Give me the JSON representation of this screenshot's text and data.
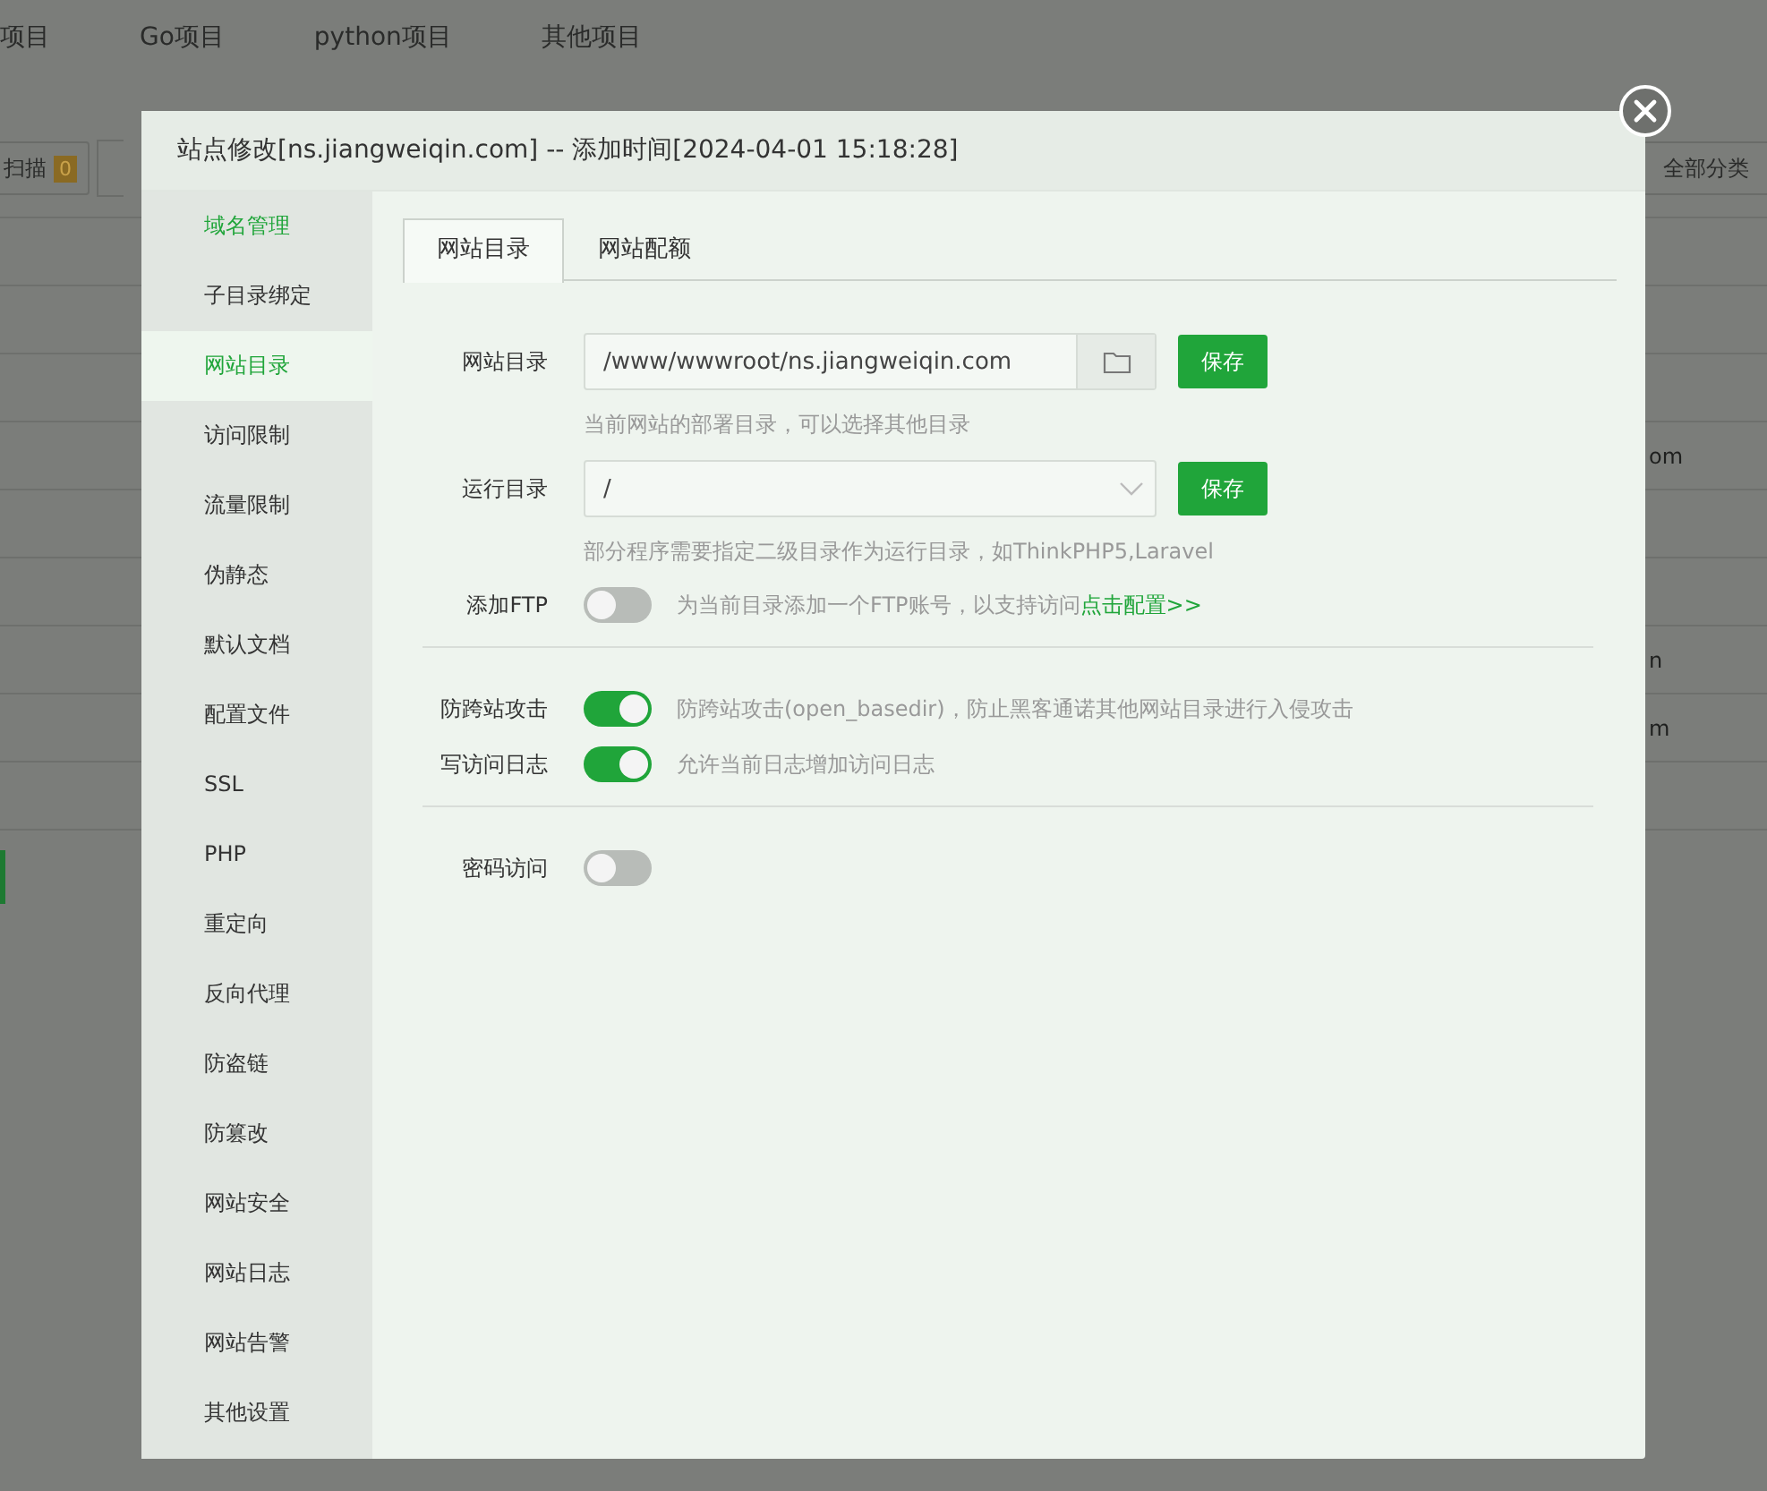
{
  "background": {
    "nav": [
      "项目",
      "Go项目",
      "python项目",
      "其他项目"
    ],
    "scan_button": {
      "label": "扫描",
      "count": "0"
    },
    "category_button": "全部分类",
    "table_fragments": [
      "om",
      "n",
      "m"
    ]
  },
  "dialog": {
    "title": "站点修改[ns.jiangweiqin.com] -- 添加时间[2024-04-01 15:18:28]",
    "sidebar": [
      {
        "label": "域名管理",
        "selected": false,
        "hover": true
      },
      {
        "label": "子目录绑定",
        "selected": false,
        "hover": false
      },
      {
        "label": "网站目录",
        "selected": true,
        "hover": false
      },
      {
        "label": "访问限制",
        "selected": false,
        "hover": false
      },
      {
        "label": "流量限制",
        "selected": false,
        "hover": false
      },
      {
        "label": "伪静态",
        "selected": false,
        "hover": false
      },
      {
        "label": "默认文档",
        "selected": false,
        "hover": false
      },
      {
        "label": "配置文件",
        "selected": false,
        "hover": false
      },
      {
        "label": "SSL",
        "selected": false,
        "hover": false
      },
      {
        "label": "PHP",
        "selected": false,
        "hover": false
      },
      {
        "label": "重定向",
        "selected": false,
        "hover": false
      },
      {
        "label": "反向代理",
        "selected": false,
        "hover": false
      },
      {
        "label": "防盗链",
        "selected": false,
        "hover": false
      },
      {
        "label": "防篡改",
        "selected": false,
        "hover": false
      },
      {
        "label": "网站安全",
        "selected": false,
        "hover": false
      },
      {
        "label": "网站日志",
        "selected": false,
        "hover": false
      },
      {
        "label": "网站告警",
        "selected": false,
        "hover": false
      },
      {
        "label": "其他设置",
        "selected": false,
        "hover": false
      }
    ],
    "tabs": [
      {
        "label": "网站目录",
        "selected": true
      },
      {
        "label": "网站配额",
        "selected": false
      }
    ],
    "rows": [
      {
        "kind": "path",
        "label": "网站目录",
        "value": "/www/wwwroot/ns.jiangweiqin.com",
        "button": "保存",
        "hint": "当前网站的部署目录，可以选择其他目录"
      },
      {
        "kind": "select",
        "label": "运行目录",
        "value": "/",
        "button": "保存",
        "hint": "部分程序需要指定二级目录作为运行目录，如ThinkPHP5,Laravel"
      },
      {
        "kind": "toggle",
        "label": "添加FTP",
        "on": false,
        "description": "为当前目录添加一个FTP账号，以支持访问",
        "link": "点击配置>>"
      },
      {
        "kind": "divider"
      },
      {
        "kind": "toggle",
        "label": "防跨站攻击",
        "on": true,
        "description": "防跨站攻击(open_basedir)，防止黑客通诺其他网站目录进行入侵攻击"
      },
      {
        "kind": "toggle",
        "label": "写访问日志",
        "on": true,
        "description": "允许当前日志增加访问日志"
      },
      {
        "kind": "divider"
      },
      {
        "kind": "toggle",
        "label": "密码访问",
        "on": false
      }
    ]
  }
}
